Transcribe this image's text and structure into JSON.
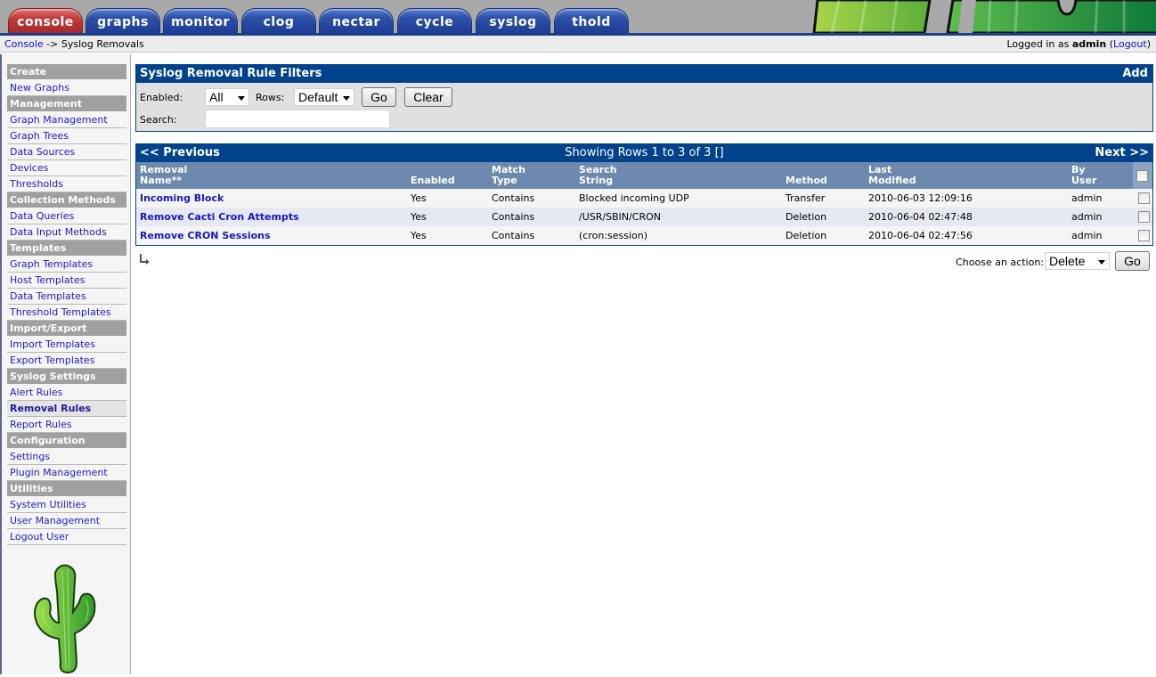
{
  "tabs": [
    {
      "label": "console",
      "active": true
    },
    {
      "label": "graphs",
      "active": false
    },
    {
      "label": "monitor",
      "active": false
    },
    {
      "label": "clog",
      "active": false
    },
    {
      "label": "nectar",
      "active": false
    },
    {
      "label": "cycle",
      "active": false
    },
    {
      "label": "syslog",
      "active": false
    },
    {
      "label": "thold",
      "active": false
    }
  ],
  "breadcrumb": {
    "root": "Console",
    "separator": " -> ",
    "current": "Syslog Removals"
  },
  "login": {
    "prefix": "Logged in as ",
    "user": "admin",
    "open_paren": " (",
    "logout": "Logout",
    "close_paren": ")"
  },
  "sidebar": {
    "sections": [
      {
        "title": "Create",
        "items": [
          {
            "label": "New Graphs"
          }
        ]
      },
      {
        "title": "Management",
        "items": [
          {
            "label": "Graph Management"
          },
          {
            "label": "Graph Trees"
          },
          {
            "label": "Data Sources"
          },
          {
            "label": "Devices"
          },
          {
            "label": "Thresholds"
          }
        ]
      },
      {
        "title": "Collection Methods",
        "items": [
          {
            "label": "Data Queries"
          },
          {
            "label": "Data Input Methods"
          }
        ]
      },
      {
        "title": "Templates",
        "items": [
          {
            "label": "Graph Templates"
          },
          {
            "label": "Host Templates"
          },
          {
            "label": "Data Templates"
          },
          {
            "label": "Threshold Templates"
          }
        ]
      },
      {
        "title": "Import/Export",
        "items": [
          {
            "label": "Import Templates"
          },
          {
            "label": "Export Templates"
          }
        ]
      },
      {
        "title": "Syslog Settings",
        "items": [
          {
            "label": "Alert Rules"
          },
          {
            "label": "Removal Rules",
            "active": true
          },
          {
            "label": "Report Rules"
          }
        ]
      },
      {
        "title": "Configuration",
        "items": [
          {
            "label": "Settings"
          },
          {
            "label": "Plugin Management"
          }
        ]
      },
      {
        "title": "Utilities",
        "items": [
          {
            "label": "System Utilities"
          },
          {
            "label": "User Management"
          },
          {
            "label": "Logout User"
          }
        ]
      }
    ]
  },
  "filters": {
    "title": "Syslog Removal Rule Filters",
    "add_label": "Add",
    "enabled_label": "Enabled:",
    "enabled_value": "All",
    "rows_label": "Rows:",
    "rows_value": "Default",
    "go_label": "Go",
    "clear_label": "Clear",
    "search_label": "Search:",
    "search_value": ""
  },
  "listing": {
    "prev_label": "<< Previous",
    "next_label": "Next >>",
    "showing": "Showing Rows 1 to 3 of 3 []",
    "columns": [
      {
        "line1": "Removal",
        "line2": "Name**"
      },
      {
        "line1": "",
        "line2": "Enabled"
      },
      {
        "line1": "Match",
        "line2": "Type"
      },
      {
        "line1": "Search",
        "line2": "String"
      },
      {
        "line1": "",
        "line2": "Method"
      },
      {
        "line1": "Last",
        "line2": "Modified"
      },
      {
        "line1": "By",
        "line2": "User"
      }
    ],
    "rows": [
      {
        "name": "Incoming Block",
        "enabled": "Yes",
        "match_type": "Contains",
        "search_string": "Blocked incoming UDP",
        "method": "Transfer",
        "last_modified": "2010-06-03 12:09:16",
        "by_user": "admin",
        "checked": false
      },
      {
        "name": "Remove Cacti Cron Attempts",
        "enabled": "Yes",
        "match_type": "Contains",
        "search_string": "/USR/SBIN/CRON",
        "method": "Deletion",
        "last_modified": "2010-06-04 02:47:48",
        "by_user": "admin",
        "checked": false
      },
      {
        "name": "Remove CRON Sessions",
        "enabled": "Yes",
        "match_type": "Contains",
        "search_string": "(cron:session)",
        "method": "Deletion",
        "last_modified": "2010-06-04 02:47:56",
        "by_user": "admin",
        "checked": false
      }
    ]
  },
  "actions": {
    "label": "Choose an action:",
    "selected": "Delete",
    "go_label": "Go"
  },
  "colors": {
    "header_blue": "#00438c",
    "table_header": "#6d8aae",
    "active_tab": "#c33c3c",
    "tab_blue": "#2c50a8"
  }
}
